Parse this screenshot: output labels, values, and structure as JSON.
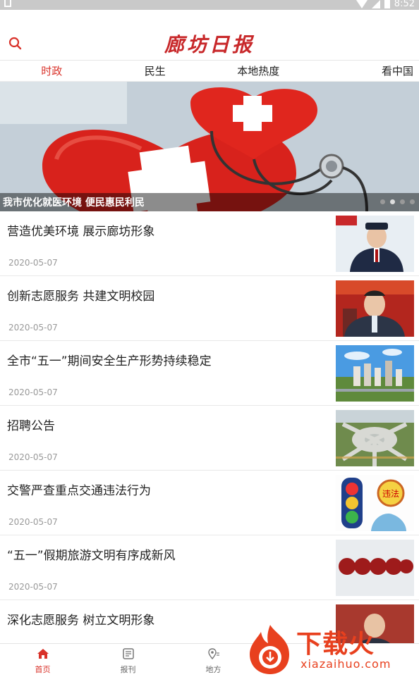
{
  "status_bar": {
    "time": "8:52"
  },
  "header": {
    "logo_text": "廊坊日报",
    "search_icon": "search-icon"
  },
  "tabs": [
    {
      "label": "时政",
      "active": true
    },
    {
      "label": "民生",
      "active": false
    },
    {
      "label": "本地热度",
      "active": false
    },
    {
      "label": "看中国",
      "active": false
    }
  ],
  "banner": {
    "caption": "我市优化就医环境 便民惠民利民",
    "slides_count": 4,
    "active_slide": 2
  },
  "news": [
    {
      "title": "营造优美环境 展示廊坊形象",
      "date": "2020-05-07",
      "thumb": "portrait-uniform"
    },
    {
      "title": "创新志愿服务 共建文明校园",
      "date": "2020-05-07",
      "thumb": "portrait-suit"
    },
    {
      "title": "全市“五一”期间安全生产形势持续稳定",
      "date": "2020-05-07",
      "thumb": "city-skyline"
    },
    {
      "title": "招聘公告",
      "date": "2020-05-07",
      "thumb": "airport-aerial"
    },
    {
      "title": "交警严查重点交通违法行为",
      "date": "2020-05-07",
      "thumb": "traffic-light-cartoon"
    },
    {
      "title": "“五一”假期旅游文明有序成新风",
      "date": "2020-05-07",
      "thumb": "holiday-banner"
    },
    {
      "title": "深化志愿服务 树立文明形象",
      "date": "",
      "thumb": "portrait-meeting"
    }
  ],
  "bottom_nav": [
    {
      "label": "首页",
      "icon": "home-icon",
      "active": true
    },
    {
      "label": "报刊",
      "icon": "newspaper-icon",
      "active": false
    },
    {
      "label": "地方",
      "icon": "location-icon",
      "active": false
    }
  ],
  "watermark": {
    "text": "下载火",
    "sub": "xiazaihuo.com"
  },
  "colors": {
    "accent": "#d9322a",
    "logo": "#c8282a"
  }
}
